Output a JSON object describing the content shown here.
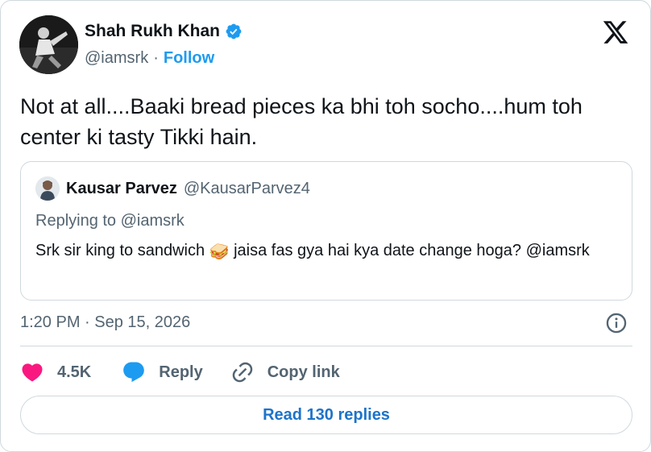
{
  "author": {
    "display_name": "Shah Rukh Khan",
    "handle": "@iamsrk",
    "separator": "·",
    "follow_label": "Follow",
    "verified_color": "#1d9bf0"
  },
  "tweet": {
    "text": "Not at all....Baaki bread pieces ka bhi toh socho....hum toh center ki tasty Tikki hain."
  },
  "quoted": {
    "display_name": "Kausar Parvez",
    "handle": "@KausarParvez4",
    "replying_to": "Replying to @iamsrk",
    "text_before": "Srk sir king to sandwich ",
    "emoji": "🥪",
    "text_after": " jaisa fas gya hai kya date change hoga? @iamsrk"
  },
  "meta": {
    "timestamp": "1:20 PM · Sep 15, 2026"
  },
  "actions": {
    "like_count": "4.5K",
    "reply_label": "Reply",
    "copy_label": "Copy link",
    "like_color": "#f91880",
    "reply_color": "#1d9bf0"
  },
  "footer": {
    "read_replies_label": "Read 130 replies"
  },
  "icons": [
    "x-logo-icon",
    "verified-badge-icon",
    "heart-icon",
    "reply-bubble-icon",
    "link-icon",
    "info-icon"
  ]
}
